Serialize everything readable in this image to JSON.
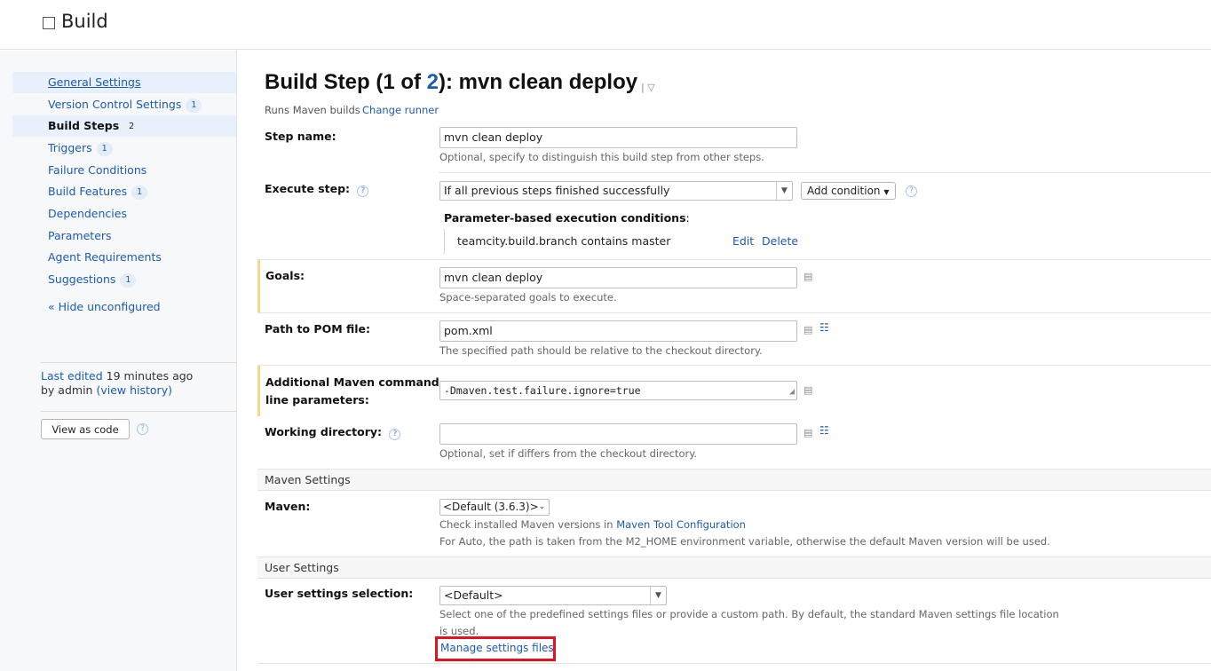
{
  "header": {
    "title": "Build"
  },
  "sidebar": {
    "items": [
      {
        "label": "General Settings",
        "count": ""
      },
      {
        "label": "Version Control Settings",
        "count": "1"
      },
      {
        "label": "Build Steps",
        "count": "2"
      },
      {
        "label": "Triggers",
        "count": "1"
      },
      {
        "label": "Failure Conditions",
        "count": ""
      },
      {
        "label": "Build Features",
        "count": "1"
      },
      {
        "label": "Dependencies",
        "count": ""
      },
      {
        "label": "Parameters",
        "count": ""
      },
      {
        "label": "Agent Requirements",
        "count": ""
      },
      {
        "label": "Suggestions",
        "count": "1"
      }
    ],
    "hide_unconfigured": "« Hide unconfigured",
    "last_edited_prefix": "Last edited",
    "last_edited_time": "19 minutes ago",
    "by_text": "by admin",
    "view_history": "(view history)",
    "view_as_code": "View as code"
  },
  "main": {
    "title_prefix": "Build Step (1 of ",
    "title_count": "2",
    "title_suffix": "): mvn clean deploy",
    "runner_description": "Runs Maven builds",
    "change_runner": "Change runner",
    "step_name": {
      "label": "Step name:",
      "value": "mvn clean deploy",
      "note": "Optional, specify to distinguish this build step from other steps."
    },
    "execute_step": {
      "label": "Execute step:",
      "value": "If all previous steps finished successfully",
      "add_condition": "Add condition",
      "conditions_title": "Parameter-based execution conditions",
      "condition": "teamcity.build.branch contains master",
      "edit": "Edit",
      "delete": "Delete"
    },
    "goals": {
      "label": "Goals:",
      "value": "mvn clean deploy",
      "note": "Space-separated goals to execute."
    },
    "pom": {
      "label": "Path to POM file:",
      "value": "pom.xml",
      "note": "The specified path should be relative to the checkout directory."
    },
    "additional": {
      "label_line1": "Additional Maven command",
      "label_line2": "line parameters:",
      "value": "-Dmaven.test.failure.ignore=true"
    },
    "working_dir": {
      "label": "Working directory:",
      "value": "",
      "note": "Optional, set if differs from the checkout directory."
    },
    "maven_settings": {
      "header": "Maven Settings",
      "label": "Maven:",
      "value": "<Default (3.6.3)>",
      "note1_prefix": "Check installed Maven versions in",
      "note1_link": "Maven Tool Configuration",
      "note2": "For Auto, the path is taken from the M2_HOME environment variable, otherwise the default Maven version will be used."
    },
    "user_settings": {
      "header": "User Settings",
      "label": "User settings selection:",
      "value": "<Default>",
      "note_line1": "Select one of the predefined settings files or provide a custom path. By default, the standard Maven settings file location",
      "note_line2": "is used.",
      "manage_link": "Manage settings files"
    }
  },
  "icons": {
    "help": "question-circle-icon",
    "text-editor": "text-editor-icon",
    "tree": "vcs-tree-icon",
    "dropdown": "chevron-down-icon"
  }
}
